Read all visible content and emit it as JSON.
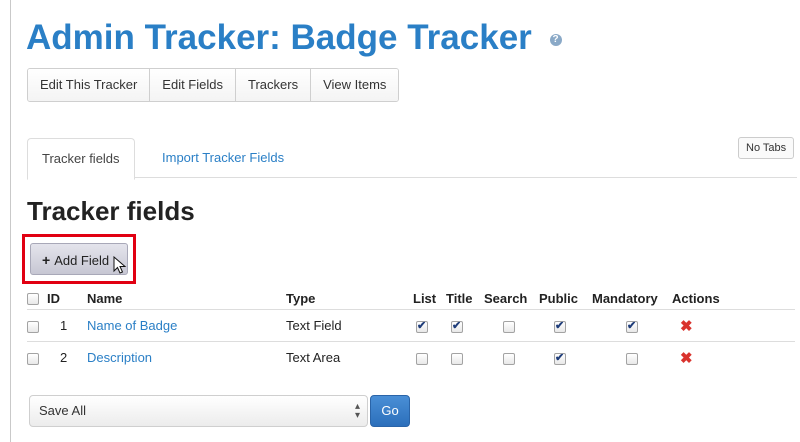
{
  "page": {
    "title": "Admin Tracker: Badge Tracker",
    "help_icon": "help-icon"
  },
  "toolbar": {
    "buttons": [
      {
        "label": "Edit This Tracker"
      },
      {
        "label": "Edit Fields"
      },
      {
        "label": "Trackers"
      },
      {
        "label": "View Items"
      }
    ]
  },
  "tabs": {
    "items": [
      {
        "label": "Tracker fields",
        "active": true
      },
      {
        "label": "Import Tracker Fields",
        "active": false
      }
    ],
    "no_tabs_label": "No Tabs"
  },
  "section": {
    "title": "Tracker fields",
    "add_button_label": "Add Field"
  },
  "table": {
    "headers": [
      "ID",
      "Name",
      "Type",
      "List",
      "Title",
      "Search",
      "Public",
      "Mandatory",
      "Actions"
    ],
    "rows": [
      {
        "id": "1",
        "name": "Name of Badge",
        "type": "Text Field",
        "list": true,
        "title": true,
        "search": false,
        "public": true,
        "mandatory": true
      },
      {
        "id": "2",
        "name": "Description",
        "type": "Text Area",
        "list": false,
        "title": false,
        "search": false,
        "public": true,
        "mandatory": false
      }
    ]
  },
  "bulk": {
    "selected_option": "Save All",
    "go_label": "Go"
  },
  "colors": {
    "link": "#2a7fc6",
    "highlight": "#e10012",
    "delete": "#d9332d",
    "go_button": "#2c6fbb"
  }
}
